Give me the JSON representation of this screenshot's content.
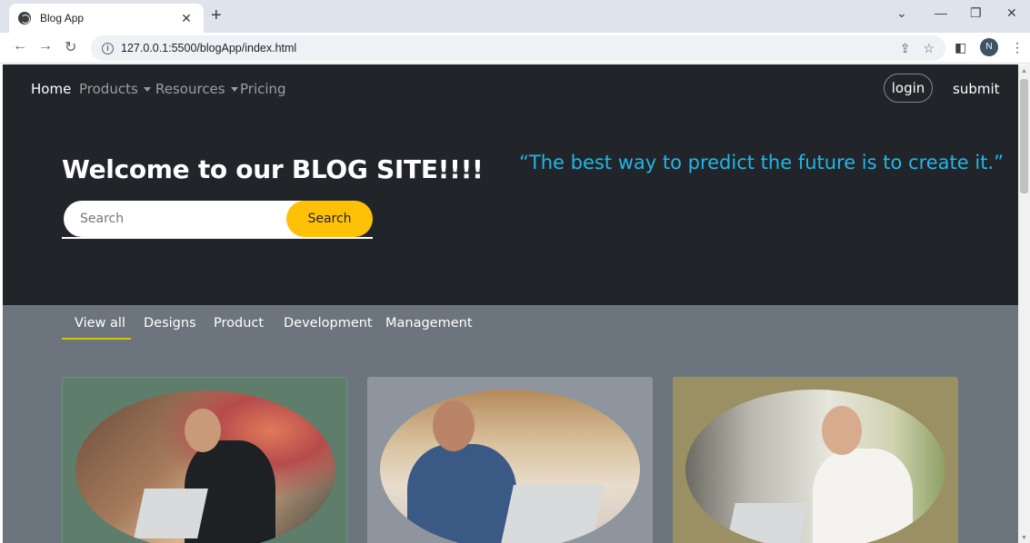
{
  "browser": {
    "tab_title": "Blog App",
    "tab_close": "✕",
    "new_tab": "+",
    "url": "127.0.0.1:5500/blogApp/index.html",
    "profile_initial": "N"
  },
  "navbar": {
    "links": [
      {
        "label": "Home",
        "active": true
      },
      {
        "label": "Products",
        "dropdown": true
      },
      {
        "label": "Resources",
        "dropdown": true
      },
      {
        "label": "Pricing"
      }
    ],
    "login_label": "login",
    "submit_label": "submit"
  },
  "hero": {
    "title": "Welcome to our BLOG SITE!!!!",
    "search_placeholder": "Search",
    "search_button": "Search",
    "quote": "“The best way to predict the future is to create it.”"
  },
  "filters": {
    "tabs": [
      "View all",
      "Designs",
      "Product",
      "Development",
      "Management"
    ],
    "active": "View all"
  },
  "colors": {
    "hero_bg": "#212529",
    "section_bg": "#6c757d",
    "accent_yellow": "#ffc107",
    "quote_blue": "#1fb7e8"
  }
}
